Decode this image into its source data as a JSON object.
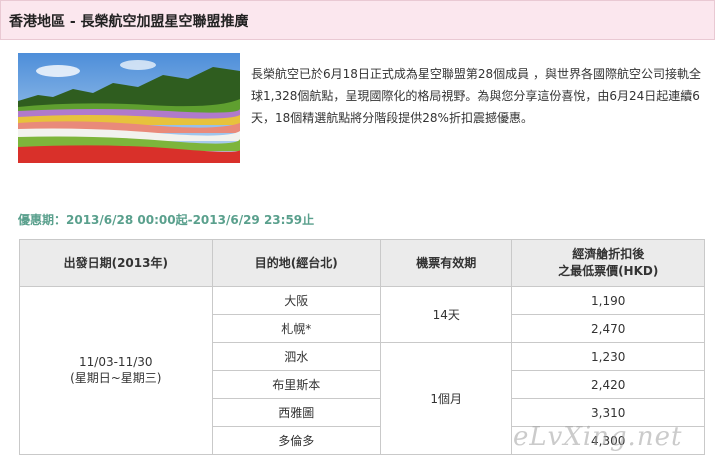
{
  "banner": {
    "title": "香港地區 - 長榮航空加盟星空聯盟推廣"
  },
  "photo": {
    "icon": "flower-field-landscape-image"
  },
  "intro": {
    "text": "長榮航空已於6月18日正式成為星空聯盟第28個成員 ，與世界各國際航空公司接軌全球1,328個航點，呈現國際化的格局視野。為與您分享這份喜悅，由6月24日起連續6天，18個精選航點將分階段提供28%折扣震撼優惠。"
  },
  "promo_period": {
    "text": "優惠期：2013/6/28 00:00起-2013/6/29 23:59止"
  },
  "table": {
    "headers": {
      "departure": "出發日期(2013年)",
      "destination": "目的地(經台北)",
      "validity": "機票有效期",
      "price_line1": "經濟艙折扣後",
      "price_line2": "之最低票價(HKD)"
    },
    "departure_dates": "11/03-11/30",
    "departure_days": "(星期日~星期三)",
    "validity_14": "14天",
    "validity_1m": "1個月",
    "rows": [
      {
        "destination": "大阪",
        "price": "1,190"
      },
      {
        "destination": "札幌*",
        "price": "2,470"
      },
      {
        "destination": "泗水",
        "price": "1,230"
      },
      {
        "destination": "布里斯本",
        "price": "2,420"
      },
      {
        "destination": "西雅圖",
        "price": "3,310"
      },
      {
        "destination": "多倫多",
        "price": "4,300"
      }
    ]
  },
  "watermark": {
    "text": "eLvXing.net"
  },
  "colors": {
    "banner_bg": "#fbe7ee",
    "period_green": "#5aa08d",
    "header_bg": "#ebebeb"
  }
}
